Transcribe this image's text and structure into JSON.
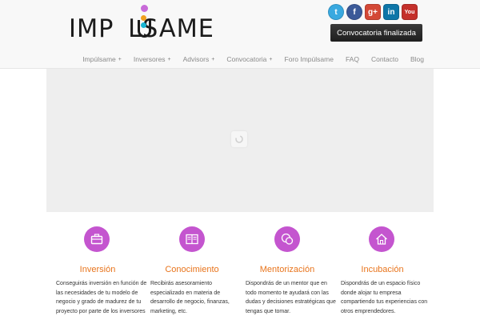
{
  "header": {
    "logo_text": "IMPULSAME",
    "social": [
      {
        "icon": "twitter-icon",
        "glyph": "t"
      },
      {
        "icon": "facebook-icon",
        "glyph": "f"
      },
      {
        "icon": "google-plus-icon",
        "glyph": "g+"
      },
      {
        "icon": "linkedin-icon",
        "glyph": "in"
      },
      {
        "icon": "youtube-icon",
        "glyph": "You"
      }
    ],
    "cta_label": "Convocatoria finalizada"
  },
  "nav": [
    {
      "label": "Impúlsame",
      "has_submenu": true
    },
    {
      "label": "Inversores",
      "has_submenu": true
    },
    {
      "label": "Advisors",
      "has_submenu": true
    },
    {
      "label": "Convocatoria",
      "has_submenu": true
    },
    {
      "label": "Foro Impúlsame",
      "has_submenu": false
    },
    {
      "label": "FAQ",
      "has_submenu": false
    },
    {
      "label": "Contacto",
      "has_submenu": false
    },
    {
      "label": "Blog",
      "has_submenu": false
    }
  ],
  "submenu_marker": "+",
  "features": [
    {
      "icon": "briefcase-icon",
      "title": "Inversión",
      "description": "Conseguirás inversión en función de las necesidades de tu modelo de negocio y grado de madurez de tu proyecto por parte de los inversores"
    },
    {
      "icon": "book-icon",
      "title": "Conocimiento",
      "description": "Recibirás asesoramiento especializado en materia de desarrollo de negocio, finanzas, marketing, etc."
    },
    {
      "icon": "chat-bubbles-icon",
      "title": "Mentorización",
      "description": "Dispondrás de un mentor que en todo momento te ayudará con las dudas y decisiones estratégicas que tengas que tomar."
    },
    {
      "icon": "house-icon",
      "title": "Incubación",
      "description": "Dispondrás de un espacio físico donde alojar tu empresa compartiendo tus experiencias con otros emprendedores."
    }
  ],
  "colors": {
    "accent_purple": "#c455cf",
    "title_orange": "#e8741c",
    "cta_background": "#2b2b2b"
  }
}
